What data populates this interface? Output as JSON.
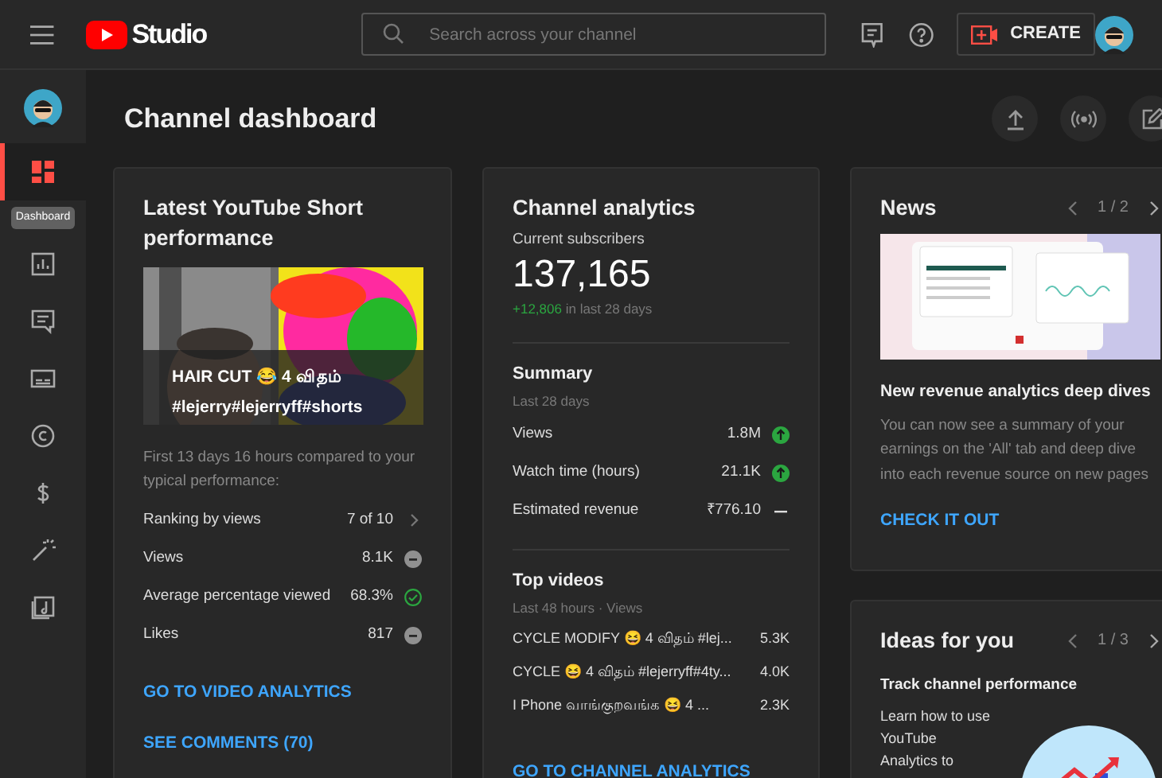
{
  "header": {
    "logo": "Studio",
    "search": {
      "placeholder": "Search across your channel"
    },
    "create": "CREATE"
  },
  "sidebar": {
    "items": [
      {
        "kind": "dashboard",
        "selected": true
      },
      {
        "kind": "analytics",
        "selected": false
      },
      {
        "kind": "comments",
        "selected": false
      },
      {
        "kind": "subtitles",
        "selected": false
      },
      {
        "kind": "copyright",
        "selected": false
      },
      {
        "kind": "earn",
        "selected": false
      },
      {
        "kind": "customization",
        "selected": false
      },
      {
        "kind": "audio",
        "selected": false
      }
    ],
    "tooltip": "Dashboard"
  },
  "page": {
    "title": "Channel dashboard"
  },
  "short_card": {
    "title": "Latest YouTube Short performance",
    "video_title": "HAIR CUT 😂 4 விதம் #lejerry#lejerryff#shorts",
    "description": "First 13 days 16 hours compared to your typical performance:",
    "rows": [
      {
        "label": "Ranking by views",
        "value": "7 of 10",
        "kind": "chevron"
      },
      {
        "label": "Views",
        "value": "8.1K",
        "kind": "neutral"
      },
      {
        "label": "Average percentage viewed",
        "value": "68.3%",
        "kind": "check"
      },
      {
        "label": "Likes",
        "value": "817",
        "kind": "neutral"
      }
    ],
    "links": [
      "GO TO VIDEO ANALYTICS",
      "SEE COMMENTS (70)"
    ]
  },
  "analytics_card": {
    "title": "Channel analytics",
    "subscribers_label": "Current subscribers",
    "subscribers": "137,165",
    "delta": "+12,806",
    "delta_suffix": "in last 28 days",
    "summary": {
      "title": "Summary",
      "subtitle": "Last 28 days",
      "rows": [
        {
          "label": "Views",
          "value": "1.8M",
          "kind": "up"
        },
        {
          "label": "Watch time (hours)",
          "value": "21.1K",
          "kind": "up"
        },
        {
          "label": "Estimated revenue",
          "value": "₹776.10",
          "kind": "dash"
        }
      ]
    },
    "top_videos": {
      "title": "Top videos",
      "subtitle": "Last 48 hours · Views",
      "rows": [
        {
          "title": "CYCLE MODIFY 😆 4 விதம் #lej...",
          "views": "5.3K"
        },
        {
          "title": "CYCLE 😆 4 விதம் #lejerryff#4ty...",
          "views": "4.0K"
        },
        {
          "title": "I Phone வாங்குறவங்க 😆 4 ...",
          "views": "2.3K"
        }
      ]
    },
    "link": "GO TO CHANNEL ANALYTICS"
  },
  "news_card": {
    "title": "News",
    "pager": "1 / 2",
    "headline": "New revenue analytics deep dives",
    "body": "You can now see a summary of your earnings on the 'All' tab and deep dive into each revenue source on new pages",
    "link": "CHECK IT OUT"
  },
  "ideas_card": {
    "title": "Ideas for you",
    "pager": "1 / 3",
    "headline": "Track channel performance",
    "body": "Learn how to use YouTube Analytics to"
  }
}
